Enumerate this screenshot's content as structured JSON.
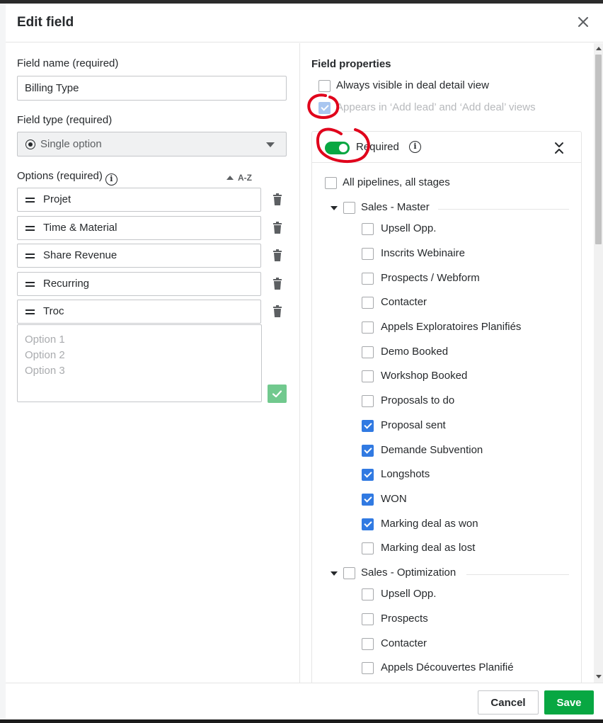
{
  "modal": {
    "title": "Edit field",
    "close_icon": "close-icon"
  },
  "left": {
    "field_name_label": "Field name (required)",
    "field_name_value": "Billing Type",
    "field_type_label": "Field type (required)",
    "field_type_value": "Single option",
    "options_label": "Options (required)",
    "sort_label": "A-Z",
    "options": [
      "Projet",
      "Time & Material",
      "Share Revenue",
      "Recurring",
      "Troc"
    ],
    "new_options_placeholder": [
      "Option 1",
      "Option 2",
      "Option 3"
    ]
  },
  "right": {
    "section_title": "Field properties",
    "always_visible": {
      "label": "Always visible in deal detail view",
      "checked": false
    },
    "appears_in_add": {
      "label": "Appears in ‘Add lead’ and ‘Add deal’ views",
      "checked": true,
      "disabled": true
    },
    "required": {
      "label": "Required",
      "enabled": true
    },
    "all_pipelines": {
      "label": "All pipelines, all stages",
      "checked": false
    },
    "pipelines": [
      {
        "name": "Sales - Master",
        "checked": false,
        "stages": [
          {
            "label": "Upsell Opp.",
            "checked": false
          },
          {
            "label": "Inscrits Webinaire",
            "checked": false
          },
          {
            "label": "Prospects / Webform",
            "checked": false
          },
          {
            "label": "Contacter",
            "checked": false
          },
          {
            "label": "Appels Exploratoires Planifiés",
            "checked": false
          },
          {
            "label": "Demo Booked",
            "checked": false
          },
          {
            "label": "Workshop Booked",
            "checked": false
          },
          {
            "label": "Proposals to do",
            "checked": false
          },
          {
            "label": "Proposal sent",
            "checked": true
          },
          {
            "label": "Demande Subvention",
            "checked": true
          },
          {
            "label": "Longshots",
            "checked": true
          },
          {
            "label": "WON",
            "checked": true
          },
          {
            "label": "Marking deal as won",
            "checked": true
          },
          {
            "label": "Marking deal as lost",
            "checked": false
          }
        ]
      },
      {
        "name": "Sales - Optimization",
        "checked": false,
        "stages": [
          {
            "label": "Upsell Opp.",
            "checked": false
          },
          {
            "label": "Prospects",
            "checked": false
          },
          {
            "label": "Contacter",
            "checked": false
          },
          {
            "label": "Appels Découvertes Planifié",
            "checked": false
          }
        ]
      }
    ]
  },
  "footer": {
    "cancel_label": "Cancel",
    "save_label": "Save"
  },
  "colors": {
    "primary_green": "#08a742",
    "checkbox_blue": "#317ae2",
    "annotation_red": "#e0001b"
  }
}
